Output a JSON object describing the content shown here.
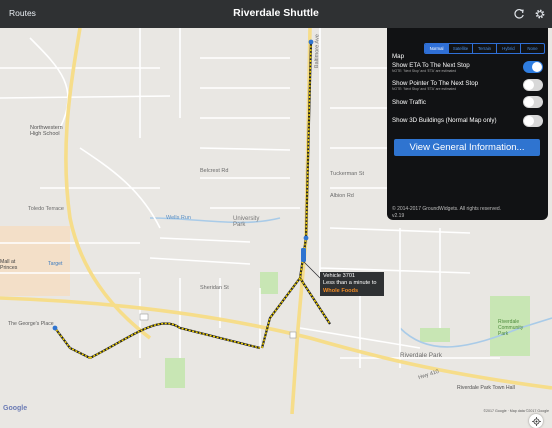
{
  "navbar": {
    "left_label": "Routes",
    "title": "Riverdale Shuttle",
    "refresh_icon": "refresh-icon",
    "settings_icon": "gear-icon"
  },
  "map": {
    "labels": {
      "northwestern": "Northwestern\nHigh School",
      "baltimore_ave": "Baltimore Ave",
      "university_park": "University\nPark",
      "riverdale_park": "Riverdale Park",
      "riverdale_community_park": "Riverdale\nCommunity\nPark",
      "hwy_410": "Hwy 410",
      "toledo_terrace": "Toledo Terrace",
      "belcrest_rd": "Belcrest Rd",
      "sheridan_st": "Sheridan St",
      "tuckerman_st": "Tuckerman St",
      "albion_rd": "Albion Rd",
      "wells_run": "Wells Run"
    },
    "pois": {
      "target": "Target",
      "mall": "Mall at\nPrinces",
      "george_place": "The George's Place",
      "riverdale_town_hall": "Riverdale Park Town Hall"
    },
    "google": "Google",
    "attribution": "©2017 Google · Map data ©2017 Google",
    "callout": {
      "vehicle": "Vehicle 3701",
      "eta": "Less than a minute to",
      "destination": "Whole Foods"
    },
    "colors": {
      "route": "#f5d400",
      "vehicle": "#2f74d0",
      "stop": "#2f74d0",
      "park": "#c8e6b4",
      "water": "#a9cbe8",
      "major_road": "#f6dd8a"
    }
  },
  "settings": {
    "map_label": "Map",
    "map_types": [
      "Normal",
      "Satellite",
      "Terrain",
      "Hybrid",
      "None"
    ],
    "map_type_selected": "Normal",
    "rows": [
      {
        "label": "Show ETA To The Next Stop",
        "note": "NOTE: 'Next Stop' and 'ETA' are estimated",
        "on": true
      },
      {
        "label": "Show Pointer To The Next Stop",
        "note": "NOTE: 'Next Stop' and 'ETA' are estimated",
        "on": false
      },
      {
        "label": "Show Traffic",
        "note": "",
        "on": false
      },
      {
        "label": "Show 3D Buildings (Normal Map only)",
        "note": "",
        "on": false
      }
    ],
    "info_button": "View General Information...",
    "copyright": "© 2014-2017 GroundWidgets.  All rights reserved.",
    "version": "v2.19"
  }
}
